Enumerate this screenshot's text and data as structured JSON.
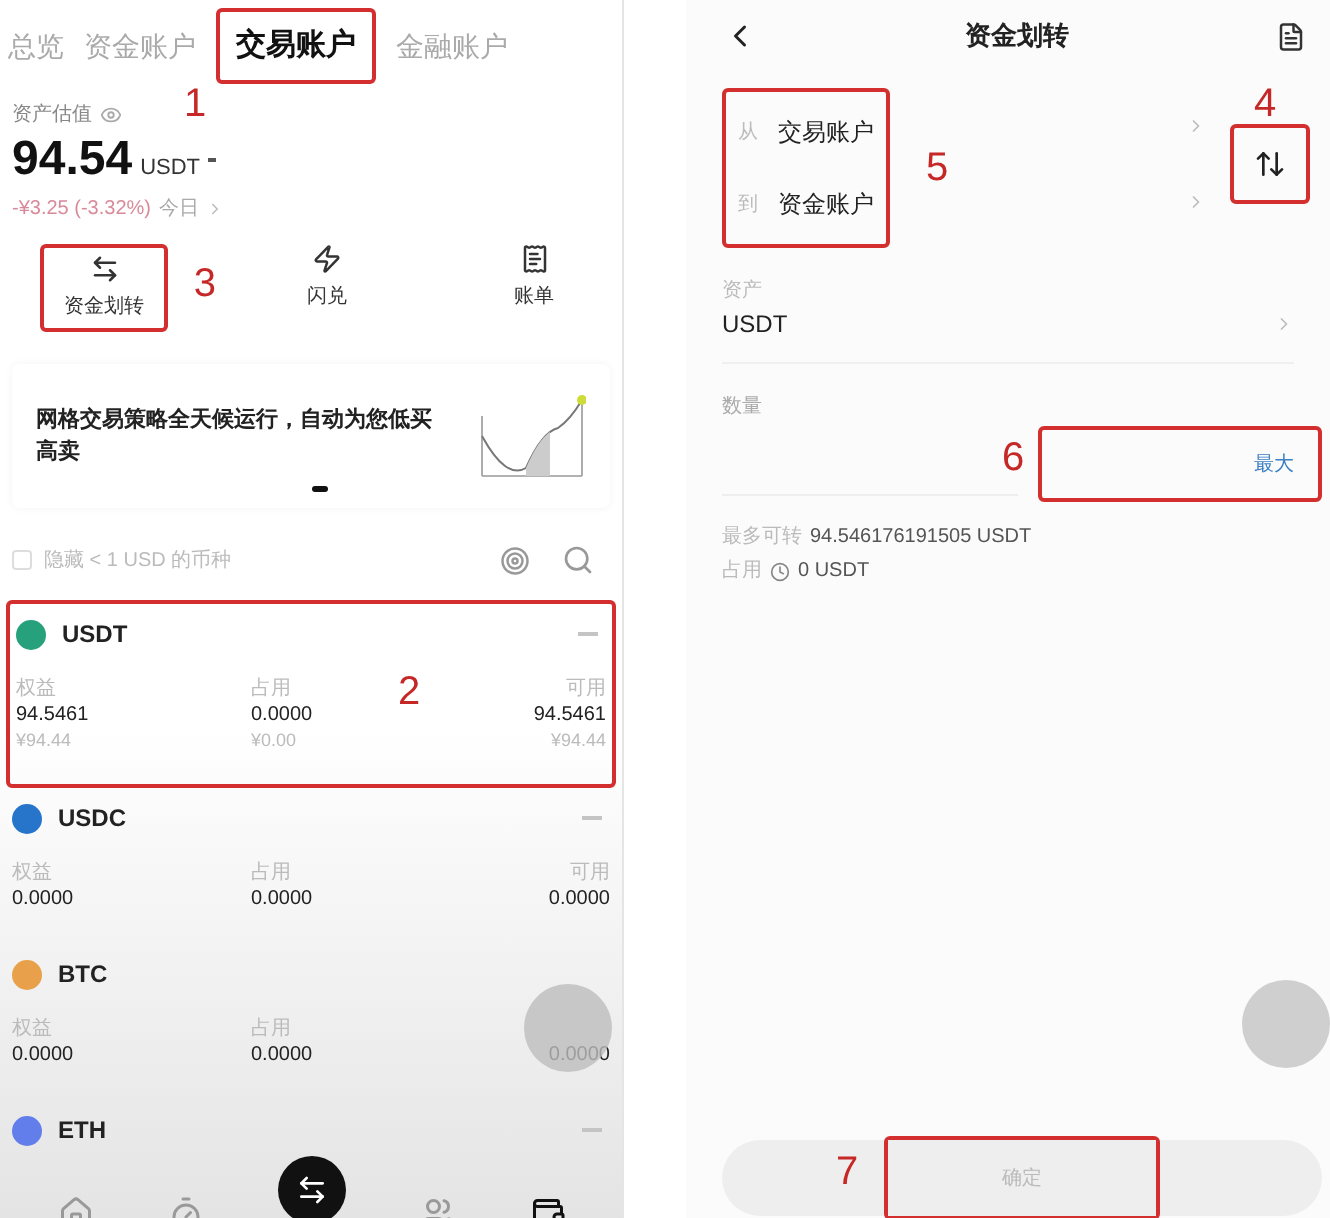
{
  "left": {
    "tabs": [
      {
        "label": "总览",
        "selected": false
      },
      {
        "label": "资金账户",
        "selected": false
      },
      {
        "label": "交易账户",
        "selected": true,
        "annotation": "1"
      },
      {
        "label": "金融账户",
        "selected": false
      }
    ],
    "valuation": {
      "label": "资产估值",
      "amount": "94.54",
      "unit": "USDT",
      "change": "-¥3.25 (-3.32%)",
      "period": "今日"
    },
    "actions": [
      {
        "kind": "transfer",
        "label": "资金划转",
        "annotation": "3"
      },
      {
        "kind": "convert",
        "label": "闪兑"
      },
      {
        "kind": "bill",
        "label": "账单"
      }
    ],
    "banner": {
      "text": "网格交易策略全天候运行，自动为您低买高卖"
    },
    "filter": {
      "label": "隐藏 < 1 USD 的币种",
      "checked": false
    },
    "assets": [
      {
        "symbol": "USDT",
        "color": "#26a17b",
        "menu": true,
        "annotation": "2",
        "columns": [
          {
            "label": "权益",
            "value": "94.5461",
            "fiat": "¥94.44"
          },
          {
            "label": "占用",
            "value": "0.0000",
            "fiat": "¥0.00"
          },
          {
            "label": "可用",
            "value": "94.5461",
            "fiat": "¥94.44"
          }
        ]
      },
      {
        "symbol": "USDC",
        "color": "#2775ca",
        "menu": true,
        "columns": [
          {
            "label": "权益",
            "value": "0.0000"
          },
          {
            "label": "占用",
            "value": "0.0000"
          },
          {
            "label": "可用",
            "value": "0.0000"
          }
        ]
      },
      {
        "symbol": "BTC",
        "color": "#e8a04b",
        "menu": false,
        "columns": [
          {
            "label": "权益",
            "value": "0.0000"
          },
          {
            "label": "占用",
            "value": "0.0000"
          },
          {
            "value": "0.0000"
          }
        ]
      },
      {
        "symbol": "ETH",
        "color": "#627eea",
        "menu": true
      }
    ]
  },
  "right": {
    "title": "资金划转",
    "route_annotation": "5",
    "swap_annotation": "4",
    "from": {
      "label": "从",
      "account": "交易账户"
    },
    "to": {
      "label": "到",
      "account": "资金账户"
    },
    "asset": {
      "label": "资产",
      "value": "USDT"
    },
    "amount": {
      "label": "数量",
      "max": "最大",
      "annotation": "6"
    },
    "max_transferable": {
      "label": "最多可转",
      "value": "94.546176191505 USDT"
    },
    "occupied": {
      "label": "占用",
      "value": "0 USDT"
    },
    "confirm": {
      "label": "确定",
      "disabled": true,
      "annotation": "7"
    }
  }
}
